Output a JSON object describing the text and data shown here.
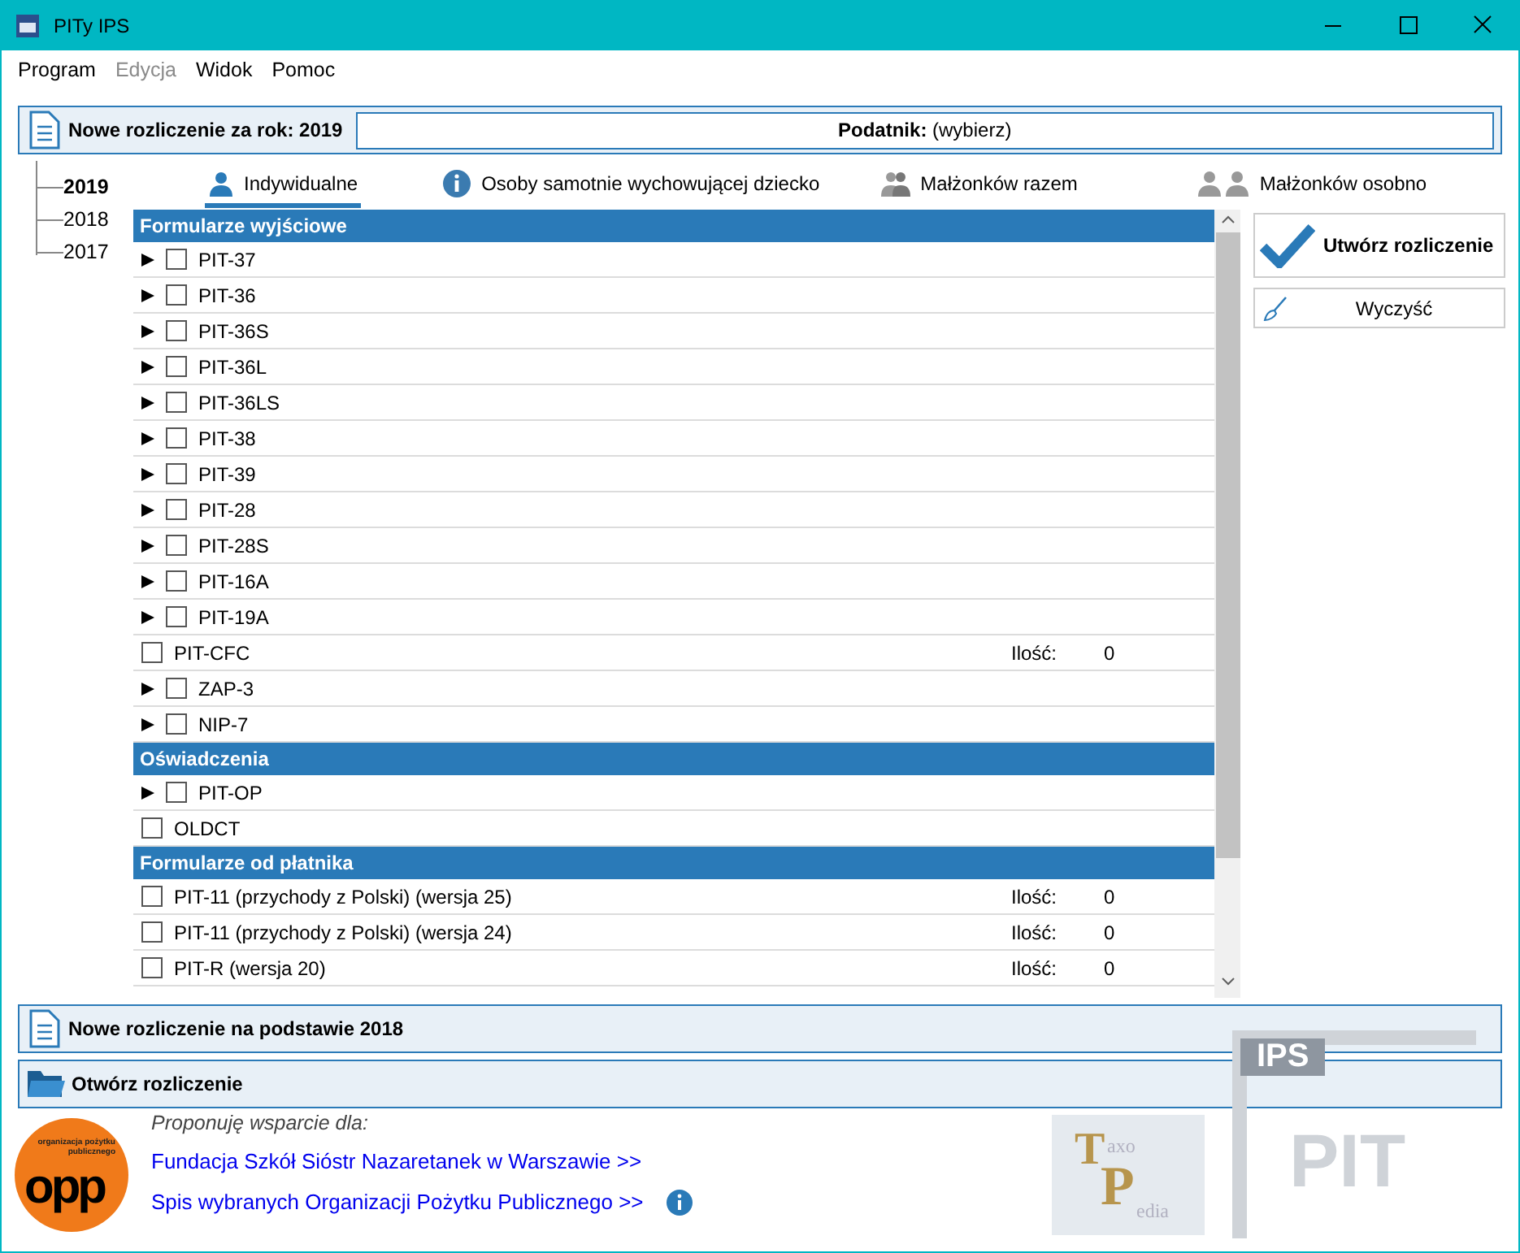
{
  "window": {
    "title": "PITy IPS"
  },
  "menu": [
    {
      "label": "Program",
      "disabled": false
    },
    {
      "label": "Edycja",
      "disabled": true
    },
    {
      "label": "Widok",
      "disabled": false
    },
    {
      "label": "Pomoc",
      "disabled": false
    }
  ],
  "new_return": {
    "title": "Nowe rozliczenie za rok: 2019",
    "taxpayer_label": "Podatnik:",
    "taxpayer_value": "(wybierz)"
  },
  "years": [
    {
      "label": "2019",
      "selected": true
    },
    {
      "label": "2018",
      "selected": false
    },
    {
      "label": "2017",
      "selected": false
    }
  ],
  "tabs": [
    {
      "label": "Indywidualne",
      "kind": "person",
      "selected": true
    },
    {
      "label": "Osoby samotnie wychowującej dziecko",
      "kind": "info",
      "selected": false
    },
    {
      "label": "Małżonków razem",
      "kind": "couple",
      "selected": false
    },
    {
      "label": "Małżonków osobno",
      "kind": "pair",
      "selected": false
    }
  ],
  "sections": [
    {
      "title": "Formularze wyjściowe",
      "rows": [
        {
          "label": "PIT-37",
          "expandable": true,
          "checked": false
        },
        {
          "label": "PIT-36",
          "expandable": true,
          "checked": false
        },
        {
          "label": "PIT-36S",
          "expandable": true,
          "checked": false
        },
        {
          "label": "PIT-36L",
          "expandable": true,
          "checked": false
        },
        {
          "label": "PIT-36LS",
          "expandable": true,
          "checked": false
        },
        {
          "label": "PIT-38",
          "expandable": true,
          "checked": false
        },
        {
          "label": "PIT-39",
          "expandable": true,
          "checked": false
        },
        {
          "label": "PIT-28",
          "expandable": true,
          "checked": false
        },
        {
          "label": "PIT-28S",
          "expandable": true,
          "checked": false
        },
        {
          "label": "PIT-16A",
          "expandable": true,
          "checked": false
        },
        {
          "label": "PIT-19A",
          "expandable": true,
          "checked": false
        },
        {
          "label": "PIT-CFC",
          "expandable": false,
          "checked": false,
          "count_label": "Ilość:",
          "count": "0"
        },
        {
          "label": "ZAP-3",
          "expandable": true,
          "checked": false
        },
        {
          "label": "NIP-7",
          "expandable": true,
          "checked": false
        }
      ]
    },
    {
      "title": "Oświadczenia",
      "rows": [
        {
          "label": "PIT-OP",
          "expandable": true,
          "checked": false
        },
        {
          "label": "OLDCT",
          "expandable": false,
          "checked": false
        }
      ]
    },
    {
      "title": "Formularze od płatnika",
      "rows": [
        {
          "label": "PIT-11 (przychody z Polski) (wersja 25)",
          "expandable": false,
          "checked": false,
          "count_label": "Ilość:",
          "count": "0"
        },
        {
          "label": "PIT-11 (przychody z Polski) (wersja 24)",
          "expandable": false,
          "checked": false,
          "count_label": "Ilość:",
          "count": "0"
        },
        {
          "label": "PIT-R (wersja 20)",
          "expandable": false,
          "checked": false,
          "count_label": "Ilość:",
          "count": "0"
        }
      ]
    }
  ],
  "actions": {
    "create": "Utwórz rozliczenie",
    "clear": "Wyczyść"
  },
  "panels": [
    {
      "label": "Nowe rozliczenie na podstawie 2018",
      "kind": "document"
    },
    {
      "label": "Otwórz rozliczenie",
      "kind": "folder"
    }
  ],
  "support": {
    "heading": "Proponuję wsparcie dla:",
    "links": [
      "Fundacja Szkół Sióstr Nazaretanek w Warszawie >>",
      "Spis wybranych Organizacji Pożytku Publicznego >>"
    ]
  },
  "logos": {
    "opp_caption": "organizacja pożytku publicznego",
    "opp_mark": "opp",
    "taxopedia": [
      "T",
      "axo",
      "P",
      "edia"
    ],
    "pit_tag": "IPS",
    "pit_mark": "PIT"
  }
}
